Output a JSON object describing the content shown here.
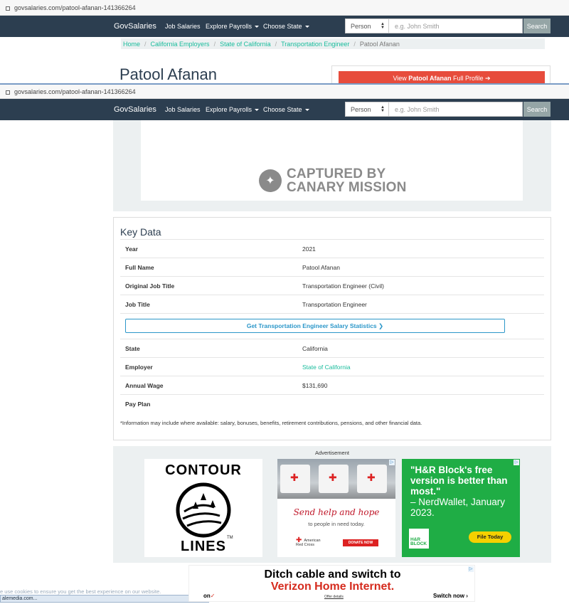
{
  "browser": {
    "url": "govsalaries.com/patool-afanan-141366264"
  },
  "nav": {
    "brand": "GovSalaries",
    "links": [
      "Job Salaries",
      "Explore Payrolls",
      "Choose State"
    ],
    "search_type": "Person",
    "search_placeholder": "e.g. John Smith",
    "search_button": "Search"
  },
  "breadcrumb": [
    "Home",
    "California Employers",
    "State of California",
    "Transportation Engineer",
    "Patool Afanan"
  ],
  "person": {
    "name": "Patool Afanan",
    "profile_btn_prefix": "View ",
    "profile_btn_name": "Patool Afanan",
    "profile_btn_suffix": " Full Profile",
    "profile_btn_arrow": "➔"
  },
  "watermark": {
    "line1": "CAPTURED BY",
    "line2": "CANARY MISSION"
  },
  "key_data": {
    "title": "Key Data",
    "rows_top": [
      {
        "label": "Year",
        "value": "2021"
      },
      {
        "label": "Full Name",
        "value": "Patool Afanan"
      },
      {
        "label": "Original Job Title",
        "value": "Transportation Engineer (Civil)"
      },
      {
        "label": "Job Title",
        "value": "Transportation Engineer"
      }
    ],
    "stats_button": "Get Transportation Engineer Salary Statistics",
    "stats_arrow": "❯",
    "rows_bottom": [
      {
        "label": "State",
        "value": "California"
      },
      {
        "label": "Employer",
        "value": "State of California"
      },
      {
        "label": "Annual Wage",
        "value": "$131,690"
      },
      {
        "label": "Pay Plan",
        "value": ""
      }
    ],
    "note": "*Information may include where available: salary, bonuses, benefits, retirement contributions, pensions, and other financial data."
  },
  "ads": {
    "label": "Advertisement",
    "contour": {
      "line1": "CONTOUR",
      "line2": "LINES",
      "tm": "TM"
    },
    "redcross": {
      "tagline": "Send help and hope",
      "sub": "to people in need today.",
      "logo_line1": "American",
      "logo_line2": "Red Cross",
      "donate": "DONATE NOW"
    },
    "hrblock": {
      "headline": "\"H&R Block's free version is better than most.\"",
      "source": "– NerdWallet, January 2023.",
      "logo_line1": "H&R",
      "logo_line2": "BLOCK",
      "cta": "File Today"
    },
    "verizon": {
      "line1": "Ditch cable and switch to",
      "line2": "Verizon Home Internet.",
      "brand": "on",
      "offer": "Offer details",
      "cta": "Switch now",
      "cta_arrow": "›"
    }
  },
  "status": {
    "cookie": "e use cookies to ensure you get the best experience on our website.",
    "bar": "alemedia.com..."
  }
}
